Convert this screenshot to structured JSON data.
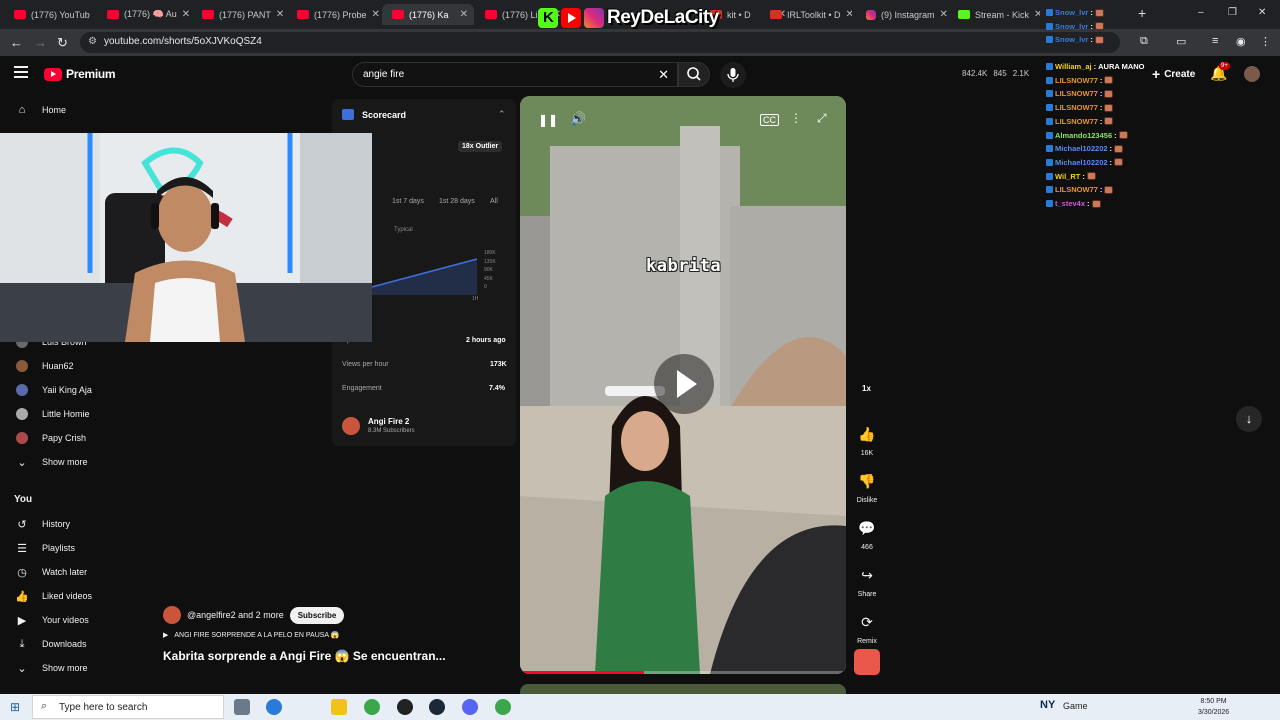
{
  "browser": {
    "tabs": [
      {
        "label": "(1776) YouTub",
        "type": "yt"
      },
      {
        "label": "(1776) 🧠 Au",
        "type": "yt"
      },
      {
        "label": "(1776) PANT",
        "type": "yt"
      },
      {
        "label": "(1776) Probe",
        "type": "yt"
      },
      {
        "label": "(1776) Ka",
        "type": "yt",
        "active": true
      },
      {
        "label": "(1776) Li",
        "type": "yt"
      },
      {
        "label": "kit • D",
        "type": "irl"
      },
      {
        "label": "IRLToolkit • D",
        "type": "irl"
      },
      {
        "label": "(9) Instagram",
        "type": "ig"
      },
      {
        "label": "Stream - Kick",
        "type": "k"
      }
    ],
    "url": "youtube.com/shorts/5oXJVKoQSZ4",
    "new_tab": "+",
    "window_controls": [
      "–",
      "❐",
      "✕"
    ]
  },
  "watermark": {
    "text": "ReyDeLaCity"
  },
  "header": {
    "logo_text": "Premium",
    "search_value": "angie fire",
    "stats": [
      "842.4K",
      "845",
      "2.1K"
    ],
    "create_label": "Create",
    "notif_count": "9+"
  },
  "sidebar": {
    "items_top": [
      {
        "label": "Home",
        "icon": "home-icon",
        "glyph": "⌂"
      }
    ],
    "subscriptions": [
      {
        "label": "Luis Brown",
        "color": "#6a6a6a"
      },
      {
        "label": "Huan62",
        "color": "#8a5a3a"
      },
      {
        "label": "Yaii King Aja",
        "color": "#5a6aaa"
      },
      {
        "label": "Little Homie",
        "color": "#aaaaaa"
      },
      {
        "label": "Papy Crish",
        "color": "#aa4a4a"
      }
    ],
    "show_more_1": "Show more",
    "you_label": "You",
    "you_items": [
      {
        "label": "History",
        "glyph": "↺"
      },
      {
        "label": "Playlists",
        "glyph": "☰"
      },
      {
        "label": "Watch later",
        "glyph": "◷"
      },
      {
        "label": "Liked videos",
        "glyph": "👍"
      },
      {
        "label": "Your videos",
        "glyph": "▶"
      },
      {
        "label": "Downloads",
        "glyph": "⤓"
      }
    ],
    "show_more_2": "Show more"
  },
  "scorecard": {
    "title": "Scorecard",
    "outlier": "18x Outlier",
    "ranges": [
      "1st 7 days",
      "1st 28 days",
      "All"
    ],
    "legend_typical": "Typical",
    "y_ticks": [
      "180K",
      "135K",
      "90K",
      "45K",
      "0"
    ],
    "x_tick": "1H",
    "rows": [
      {
        "label": "Uploaded",
        "value": "2 hours ago"
      },
      {
        "label": "Views per hour",
        "value": "173K"
      },
      {
        "label": "Engagement",
        "value": "7.4%"
      }
    ],
    "channel_name": "Angi Fire 2",
    "channel_subs": "8.3M Subscribers"
  },
  "video": {
    "overlay_text": "kabrita",
    "progress": 0.38,
    "speed": "1x"
  },
  "actions": [
    {
      "name": "like",
      "glyph": "👍",
      "label": "16K"
    },
    {
      "name": "dislike",
      "glyph": "👎",
      "label": "Dislike"
    },
    {
      "name": "comments",
      "glyph": "💬",
      "label": "466"
    },
    {
      "name": "share",
      "glyph": "↪",
      "label": "Share"
    },
    {
      "name": "remix",
      "glyph": "⟳",
      "label": "Remix"
    }
  ],
  "below": {
    "channel_text": "@angelfire2 and 2 more",
    "subscribe_label": "Subscribe",
    "tag_line": "ANGI FIRE SORPRENDE A LA PELO EN PAUSA 😱",
    "title": "Kabrita sorprende a Angi Fire 😱 Se encuentran..."
  },
  "chat": [
    {
      "user": "Snow_lvr",
      "color": "#3a7ad8",
      "msg": "",
      "emote": true
    },
    {
      "user": "Snow_lvr",
      "color": "#3a7ad8",
      "msg": "",
      "emote": true
    },
    {
      "user": "Snow_lvr",
      "color": "#3a7ad8",
      "msg": "",
      "emote": true
    },
    {
      "user": "William_aj",
      "color": "#f2d21a",
      "msg": "AURA MANO",
      "emote": false
    },
    {
      "user": "LILSNOW77",
      "color": "#e8962a",
      "msg": "",
      "emote": true
    },
    {
      "user": "LILSNOW77",
      "color": "#e8962a",
      "msg": "",
      "emote": true
    },
    {
      "user": "LILSNOW77",
      "color": "#e8962a",
      "msg": "",
      "emote": true
    },
    {
      "user": "LILSNOW77",
      "color": "#e8962a",
      "msg": "",
      "emote": true
    },
    {
      "user": "Almando123456",
      "color": "#8ee06a",
      "msg": "",
      "emote": true
    },
    {
      "user": "Michael102202",
      "color": "#5a8af0",
      "msg": "",
      "emote": true
    },
    {
      "user": "Michael102202",
      "color": "#5a8af0",
      "msg": "",
      "emote": true
    },
    {
      "user": "Wil_RT",
      "color": "#f2d21a",
      "msg": "",
      "emote": true
    },
    {
      "user": "LILSNOW77",
      "color": "#e8962a",
      "msg": "",
      "emote": true
    },
    {
      "user": "t_stev4x",
      "color": "#d25ad8",
      "msg": "",
      "emote": true
    }
  ],
  "taskbar": {
    "search_placeholder": "Type here to search",
    "game_label": "Game",
    "time": "8:50 PM",
    "date": "3/30/2026"
  }
}
